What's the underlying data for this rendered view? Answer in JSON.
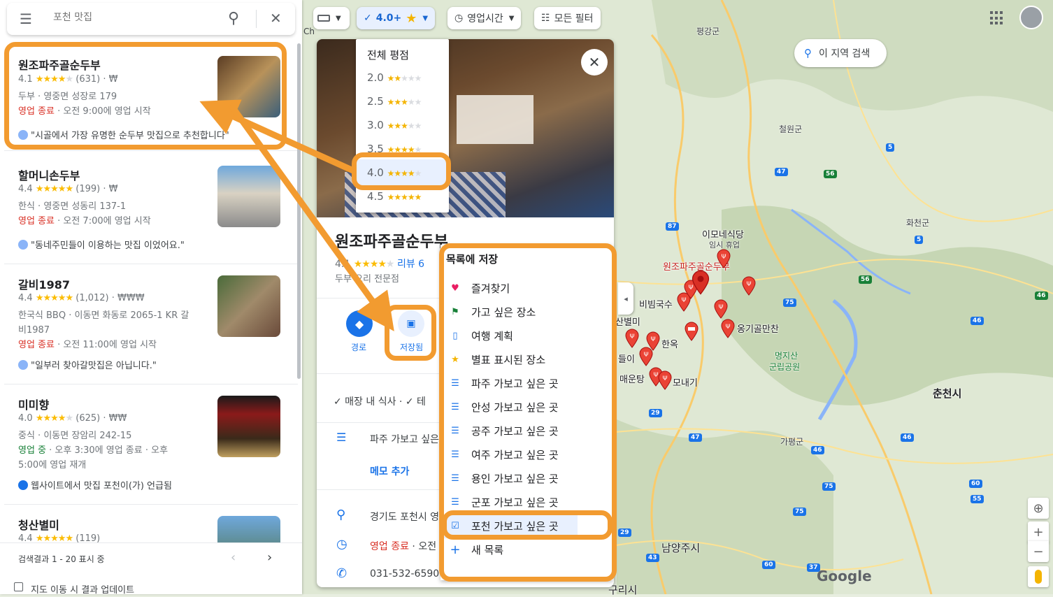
{
  "search": {
    "placeholder": "포천 맛집"
  },
  "filters": {
    "rating": "4.0+",
    "hours": "영업시간",
    "all": "모든 필터",
    "ch": "Ch"
  },
  "rating_menu": {
    "title": "전체 평점",
    "items": [
      {
        "label": "2.0",
        "stars": "★★",
        "empty": "★★★"
      },
      {
        "label": "2.5",
        "stars": "★★★",
        "empty": "★★"
      },
      {
        "label": "3.0",
        "stars": "★★★",
        "empty": "★★"
      },
      {
        "label": "3.5",
        "stars": "★★★★",
        "empty": "★"
      },
      {
        "label": "4.0",
        "stars": "★★★★",
        "empty": "★"
      },
      {
        "label": "4.5",
        "stars": "★★★★★",
        "empty": ""
      }
    ]
  },
  "results": [
    {
      "name": "원조파주골순두부",
      "rating": "4.1",
      "stars": "★★★★",
      "empty": "★",
      "meta": "(631) · ₩",
      "addr": "두부 · 영중면 성장로 179",
      "status": "영업 종료",
      "hours": " · 오전 9:00에 영업 시작",
      "quote": "\"시골에서 가장 유명한 순두부 맛집으로 추천합니다\""
    },
    {
      "name": "할머니손두부",
      "rating": "4.4",
      "stars": "★★★★★",
      "empty": "",
      "meta": "(199) · ₩",
      "addr": "한식 · 영중면 성동리 137-1",
      "status": "영업 종료",
      "hours": " · 오전 7:00에 영업 시작",
      "quote": "\"동네주민들이 이용하는 맛집 이었어요.\""
    },
    {
      "name": "갈비1987",
      "rating": "4.4",
      "stars": "★★★★★",
      "empty": "",
      "meta": "(1,012) · ₩₩₩",
      "addr": "한국식 BBQ · 이동면 화동로 2065-1 KR 갈",
      "addr2": "비1987",
      "status": "영업 종료",
      "hours": " · 오전 11:00에 영업 시작",
      "quote": "\"일부러 찾아갈맛집은 아닙니다.\""
    },
    {
      "name": "미미향",
      "rating": "4.0",
      "stars": "★★★★",
      "empty": "★",
      "meta": "(625) · ₩₩",
      "addr": "중식 · 이동면 장암리 242-15",
      "status": "영업 중",
      "hours": " · 오후 3:30에 영업 종료 · 오후",
      "hours2": "5:00에 영업 재개",
      "quote": "웹사이트에서 맛집 포천이(가) 언급됨"
    },
    {
      "name": "청산별미",
      "rating": "4.4",
      "stars": "★★★★★",
      "empty": "",
      "meta": "(119)"
    }
  ],
  "footer": {
    "count": "검색결과 1 - 20 표시 중",
    "update": "지도 이동 시 결과 업데이트"
  },
  "detail": {
    "name": "원조파주골순두부",
    "rating": "4.1",
    "reviews": "리뷰 6",
    "category": "두부 요리 전문점",
    "route": "경로",
    "saved": "저장됨",
    "services": "✓ 매장 내 식사 · ✓ 테",
    "list": "파주 가보고 싶은",
    "memo": "메모 추가",
    "address": "경기도 포천시 영",
    "status": "영업 종료",
    "hours": " · 오전",
    "phone": "031-532-6590"
  },
  "save_menu": {
    "title": "목록에 저장",
    "items": [
      {
        "label": "즐겨찾기",
        "icon": "heart-icon",
        "color": "#e91e63"
      },
      {
        "label": "가고 싶은 장소",
        "icon": "flag-icon",
        "color": "#188038"
      },
      {
        "label": "여행 계획",
        "icon": "suitcase-icon",
        "color": "#1a73e8"
      },
      {
        "label": "별표 표시된 장소",
        "icon": "star-icon",
        "color": "#f4b400"
      },
      {
        "label": "파주 가보고 싶은 곳",
        "icon": "list-icon",
        "color": "#1a73e8"
      },
      {
        "label": "안성 가보고 싶은 곳",
        "icon": "list-icon",
        "color": "#1a73e8"
      },
      {
        "label": "공주 가보고 싶은 곳",
        "icon": "list-icon",
        "color": "#1a73e8"
      },
      {
        "label": "여주 가보고 싶은 곳",
        "icon": "list-icon",
        "color": "#1a73e8"
      },
      {
        "label": "용인 가보고 싶은 곳",
        "icon": "list-icon",
        "color": "#1a73e8"
      },
      {
        "label": "군포 가보고 싶은 곳",
        "icon": "list-icon",
        "color": "#1a73e8"
      },
      {
        "label": "포천 가보고 싶은 곳",
        "icon": "list-check-icon",
        "color": "#1a73e8"
      },
      {
        "label": "새 목록",
        "icon": "plus-icon",
        "color": "#1a73e8"
      }
    ]
  },
  "map": {
    "search_area": "이 지역 검색",
    "towns": [
      "평강군",
      "철원군",
      "화천군",
      "이모네식당",
      "임시 휴업",
      "원조파주골순두부",
      "비빔국수",
      "옹기골만찬",
      "명지산",
      "군립공원",
      "한옥",
      "들이",
      "매운탕",
      "모내기",
      "산별미",
      "춘천시",
      "가평군",
      "남양주시",
      "구리시",
      "Google"
    ],
    "shields": [
      "5",
      "47",
      "56",
      "87",
      "5",
      "56",
      "75",
      "46",
      "37",
      "29",
      "47",
      "46",
      "75",
      "46",
      "75",
      "60",
      "55",
      "43",
      "29",
      "46",
      "60",
      "37"
    ]
  },
  "colors": {
    "accent": "#f29b30",
    "blue": "#1a73e8",
    "red": "#d93025",
    "green": "#188038"
  }
}
